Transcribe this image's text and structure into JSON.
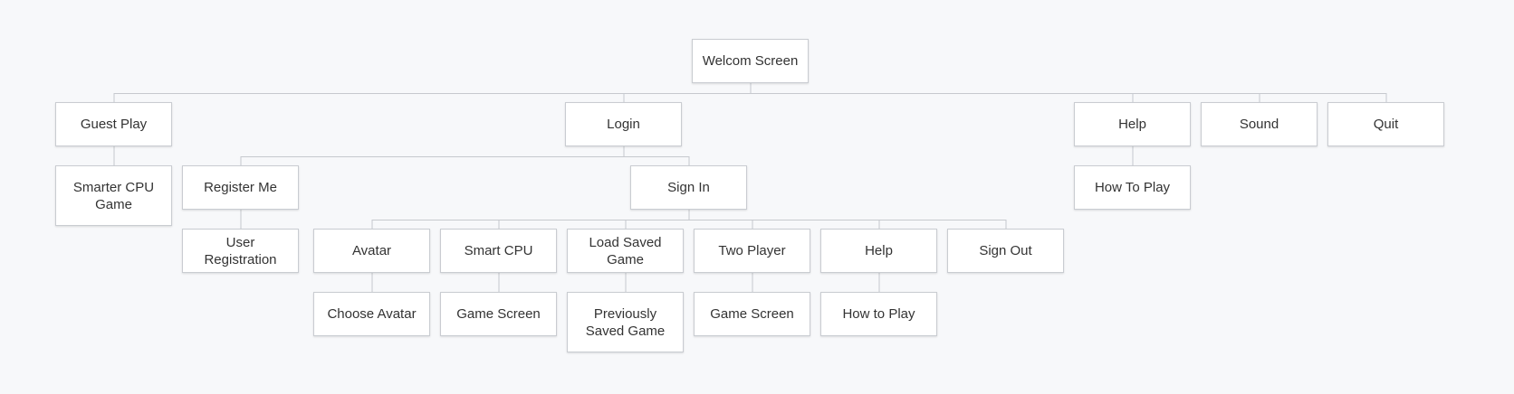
{
  "colors": {
    "background": "#f7f8fa",
    "node_fill": "#ffffff",
    "node_border": "#c9ccd1",
    "connector": "#c6c9ce",
    "text": "#333333"
  },
  "nodes": [
    {
      "id": "welcome",
      "label": "Welcom Screen"
    },
    {
      "id": "guest-play",
      "label": "Guest Play"
    },
    {
      "id": "login",
      "label": "Login"
    },
    {
      "id": "help",
      "label": "Help"
    },
    {
      "id": "sound",
      "label": "Sound"
    },
    {
      "id": "quit",
      "label": "Quit"
    },
    {
      "id": "smarter-cpu-game",
      "label": "Smarter CPU Game"
    },
    {
      "id": "register-me",
      "label": "Register Me"
    },
    {
      "id": "sign-in",
      "label": "Sign In"
    },
    {
      "id": "how-to-play-top",
      "label": "How To Play"
    },
    {
      "id": "user-registration",
      "label": "User Registration"
    },
    {
      "id": "avatar",
      "label": "Avatar"
    },
    {
      "id": "smart-cpu",
      "label": "Smart CPU"
    },
    {
      "id": "load-saved-game",
      "label": "Load Saved Game"
    },
    {
      "id": "two-player",
      "label": "Two Player"
    },
    {
      "id": "help-sub",
      "label": "Help"
    },
    {
      "id": "sign-out",
      "label": "Sign Out"
    },
    {
      "id": "choose-avatar",
      "label": "Choose Avatar"
    },
    {
      "id": "game-screen-1",
      "label": "Game Screen"
    },
    {
      "id": "previously-saved-game",
      "label": "Previously Saved Game"
    },
    {
      "id": "game-screen-2",
      "label": "Game Screen"
    },
    {
      "id": "how-to-play-sub",
      "label": "How to Play"
    }
  ],
  "edges": [
    [
      "welcome",
      "guest-play"
    ],
    [
      "welcome",
      "login"
    ],
    [
      "welcome",
      "help"
    ],
    [
      "welcome",
      "sound"
    ],
    [
      "welcome",
      "quit"
    ],
    [
      "guest-play",
      "smarter-cpu-game"
    ],
    [
      "login",
      "register-me"
    ],
    [
      "login",
      "sign-in"
    ],
    [
      "help",
      "how-to-play-top"
    ],
    [
      "register-me",
      "user-registration"
    ],
    [
      "sign-in",
      "avatar"
    ],
    [
      "sign-in",
      "smart-cpu"
    ],
    [
      "sign-in",
      "load-saved-game"
    ],
    [
      "sign-in",
      "two-player"
    ],
    [
      "sign-in",
      "help-sub"
    ],
    [
      "sign-in",
      "sign-out"
    ],
    [
      "avatar",
      "choose-avatar"
    ],
    [
      "smart-cpu",
      "game-screen-1"
    ],
    [
      "load-saved-game",
      "previously-saved-game"
    ],
    [
      "two-player",
      "game-screen-2"
    ],
    [
      "help-sub",
      "how-to-play-sub"
    ]
  ]
}
